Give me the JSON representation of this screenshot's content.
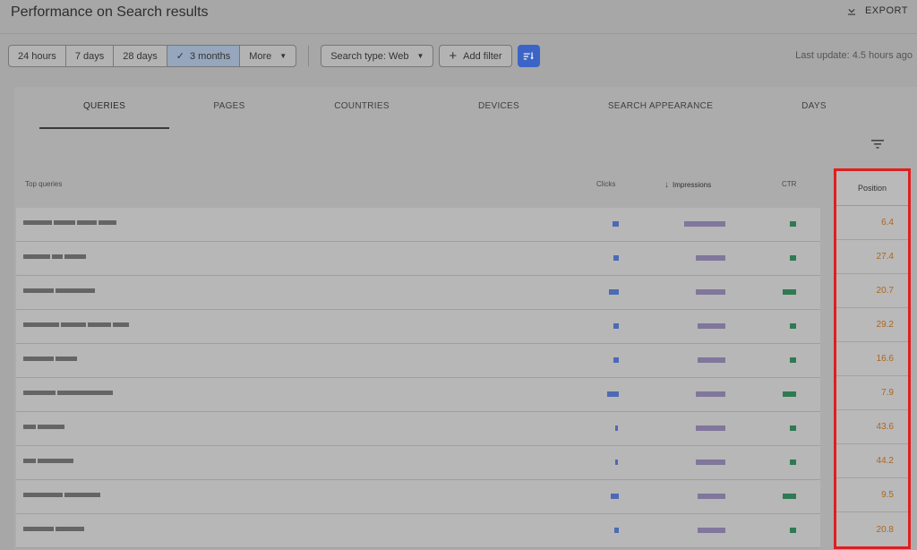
{
  "header": {
    "title": "Performance on Search results",
    "export_label": "EXPORT",
    "export_icon": "download-icon"
  },
  "filters": {
    "ranges": [
      "24 hours",
      "7 days",
      "28 days",
      "3 months",
      "More"
    ],
    "active_range": "3 months",
    "search_type": "Search type: Web",
    "add_filter": "Add filter",
    "last_update": "Last update: 4.5 hours ago"
  },
  "tabs": [
    "QUERIES",
    "PAGES",
    "COUNTRIES",
    "DEVICES",
    "SEARCH APPEARANCE",
    "DAYS"
  ],
  "active_tab": "QUERIES",
  "table": {
    "columns": {
      "query": "Top queries",
      "clicks": "Clicks",
      "impressions": "Impressions",
      "ctr": "CTR",
      "position": "Position"
    },
    "positions": [
      "6.4",
      "27.4",
      "20.7",
      "29.2",
      "16.6",
      "7.9",
      "43.6",
      "44.2",
      "9.5",
      "20.8"
    ]
  },
  "colors": {
    "accent": "#3b64c6",
    "position_text": "#b0651c",
    "highlight_border": "#e01e1e"
  }
}
